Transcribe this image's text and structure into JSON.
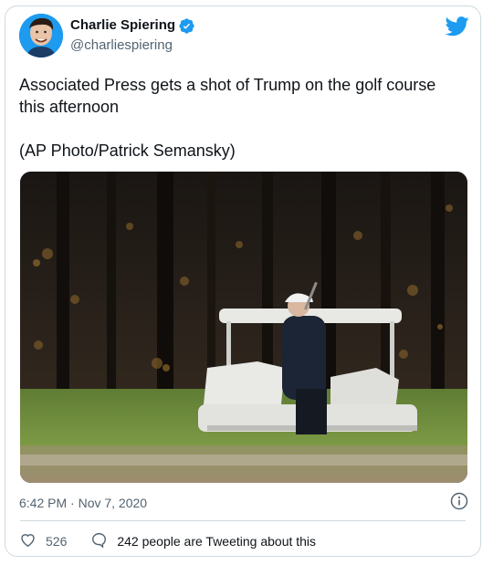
{
  "author": {
    "display_name": "Charlie Spiering",
    "handle": "@charliespiering",
    "verified": true,
    "avatar_icon": "profile-photo"
  },
  "tweet": {
    "text": "Associated Press gets a shot of Trump on the golf course\nthis afternoon\n\n(AP Photo/Patrick Semansky)",
    "timestamp": "6:42 PM · Nov 7, 2020"
  },
  "media": {
    "type": "photo"
  },
  "actions": {
    "likes": "526",
    "tweeting": "242 people are Tweeting about this"
  },
  "colors": {
    "brand": "#1d9bf0",
    "secondary_text": "#536471",
    "border": "#cfd9de"
  },
  "icons": {
    "brand": "twitter-bird-icon",
    "verified": "verified-badge-icon",
    "info": "info-icon",
    "like": "heart-icon",
    "reply": "speech-bubble-icon"
  }
}
